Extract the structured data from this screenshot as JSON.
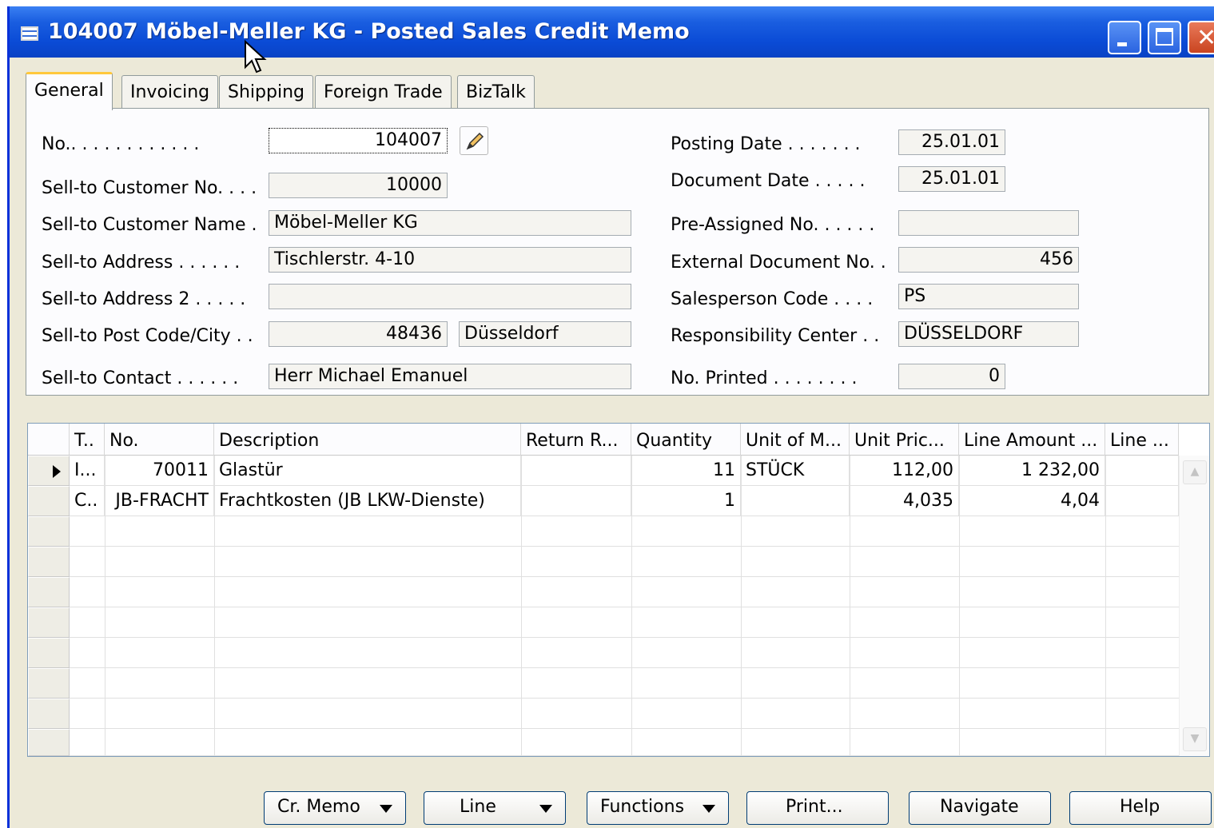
{
  "window": {
    "title": "104007 Möbel-Meller KG - Posted Sales Credit Memo",
    "controls": [
      "minimize",
      "maximize",
      "close"
    ]
  },
  "tabs": [
    {
      "label": "General",
      "active": true
    },
    {
      "label": "Invoicing",
      "active": false
    },
    {
      "label": "Shipping",
      "active": false
    },
    {
      "label": "Foreign Trade",
      "active": false
    },
    {
      "label": "BizTalk",
      "active": false
    }
  ],
  "general": {
    "left": {
      "no": {
        "label": "No.",
        "dots": ". . . . . . . . . . . .",
        "value": "104007"
      },
      "sell_to_customer_no": {
        "label": "Sell-to Customer No.",
        "dots": ". . .",
        "value": "10000"
      },
      "sell_to_customer_name": {
        "label": "Sell-to Customer Name",
        "dots": ".",
        "value": "Möbel-Meller KG"
      },
      "sell_to_address": {
        "label": "Sell-to Address",
        "dots": ". . . . . .",
        "value": "Tischlerstr. 4-10"
      },
      "sell_to_address_2": {
        "label": "Sell-to Address 2",
        "dots": ". . . . .",
        "value": ""
      },
      "sell_to_post_code_city": {
        "label": "Sell-to Post Code/City",
        "dots": ". .",
        "post_code": "48436",
        "city": "Düsseldorf"
      },
      "sell_to_contact": {
        "label": "Sell-to Contact",
        "dots": ". . . . . .",
        "value": "Herr Michael Emanuel"
      }
    },
    "right": {
      "posting_date": {
        "label": "Posting Date",
        "dots": ". . . . . . .",
        "value": "25.01.01"
      },
      "document_date": {
        "label": "Document Date",
        "dots": ". . . . .",
        "value": "25.01.01"
      },
      "pre_assigned_no": {
        "label": "Pre-Assigned No.",
        "dots": ". . . . .",
        "value": ""
      },
      "external_document_no": {
        "label": "External Document No.",
        "dots": ".",
        "value": "456"
      },
      "salesperson_code": {
        "label": "Salesperson Code",
        "dots": ". . . .",
        "value": "PS"
      },
      "responsibility_center": {
        "label": "Responsibility Center",
        "dots": ". .",
        "value": "DÜSSELDORF"
      },
      "no_printed": {
        "label": "No. Printed",
        "dots": ". . . . . . . .",
        "value": "0"
      }
    }
  },
  "lines": {
    "columns": [
      "T..",
      "No.",
      "Description",
      "Return R...",
      "Quantity",
      "Unit of M...",
      "Unit Pric...",
      "Line Amount ...",
      "Line ..."
    ],
    "rows": [
      {
        "type": "I...",
        "no": "70011",
        "description": "Glastür",
        "return_reason": "",
        "quantity": "11",
        "unit_of_measure": "STÜCK",
        "unit_price": "112,00",
        "line_amount": "1 232,00",
        "line_extra": "",
        "current": true
      },
      {
        "type": "C..",
        "no": "JB-FRACHT",
        "description": "Frachtkosten (JB LKW-Dienste)",
        "return_reason": "",
        "quantity": "1",
        "unit_of_measure": "",
        "unit_price": "4,035",
        "line_amount": "4,04",
        "line_extra": "",
        "current": false
      }
    ],
    "empty_rows": 8
  },
  "buttons": {
    "cr_memo": "Cr. Memo",
    "line": "Line",
    "functions": "Functions",
    "print": "Print...",
    "navigate": "Navigate",
    "help": "Help"
  },
  "colors": {
    "titlebar": "#0a4bd6",
    "window_face": "#ece9d8",
    "active_tab_accent": "#ffc83c"
  }
}
